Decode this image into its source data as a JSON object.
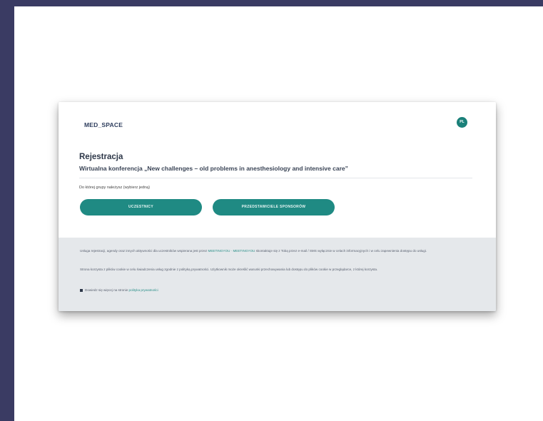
{
  "header": {
    "logo": "MED_SPACE",
    "lang": "PL"
  },
  "main": {
    "title": "Rejestracja",
    "subtitle": "Wirtualna konferencja „New challenges – old problems in anesthesiology and intensive care”",
    "question": "Do której grupy należysz (wybierz jedną)",
    "buttons": {
      "participants": "UCZESTNICY",
      "sponsors": "PRZEDSTAWICIELE SPONSORÓW"
    }
  },
  "footer": {
    "p1_a": "Usługa rejestracji, agendy oraz innych aktywności dla uczestników wspierana jest przez ",
    "p1_link": "MEETINGYOU · MEETINGYOU",
    "p1_b": " skontaktuje się z Tobą przez e-mail / SMS wyłącznie w celach informacyjnych i w celu zapewnienia dostępu do usługi.",
    "p2": "Strona korzysta z plików cookie w celu świadczenia usług zgodnie z polityką prywatności. Użytkownik może określić warunki przechowywania lub dostępu do plików cookie w przeglądarce, z której korzysta.",
    "p3_a": "Dowiedz się więcej na stronie ",
    "p3_link": "polityka prywatności"
  },
  "colors": {
    "accent": "#1f8a83",
    "frame": "#3a3b63",
    "footer_bg": "#e5e8eb"
  }
}
